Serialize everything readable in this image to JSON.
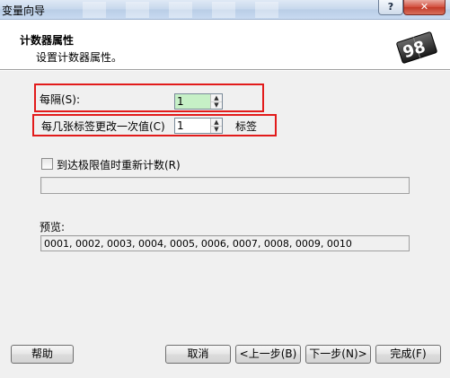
{
  "window": {
    "title": "变量向导",
    "help_button": "?",
    "close_button": "✕"
  },
  "header": {
    "title": "计数器属性",
    "subtitle": "设置计数器属性。",
    "logo_text": "98"
  },
  "fields": {
    "interval_label": "每隔(S):",
    "interval_value": "1",
    "change_every_label": "每几张标签更改一次值(C)",
    "change_every_value": "1",
    "change_every_unit": "标签"
  },
  "reset": {
    "checkbox_label": "到达极限值时重新计数(R)",
    "checked": false,
    "value": ""
  },
  "preview": {
    "label": "预览:",
    "text": "0001, 0002, 0003, 0004, 0005, 0006, 0007, 0008, 0009, 0010"
  },
  "buttons": {
    "help": "帮助",
    "cancel": "取消",
    "back": "<上一步(B)",
    "next": "下一步(N)>",
    "finish": "完成(F)"
  },
  "colors": {
    "highlight_border": "#e21b1b",
    "interval_field_bg": "#c6f0c6",
    "dialog_bg": "#f0f0f0"
  }
}
